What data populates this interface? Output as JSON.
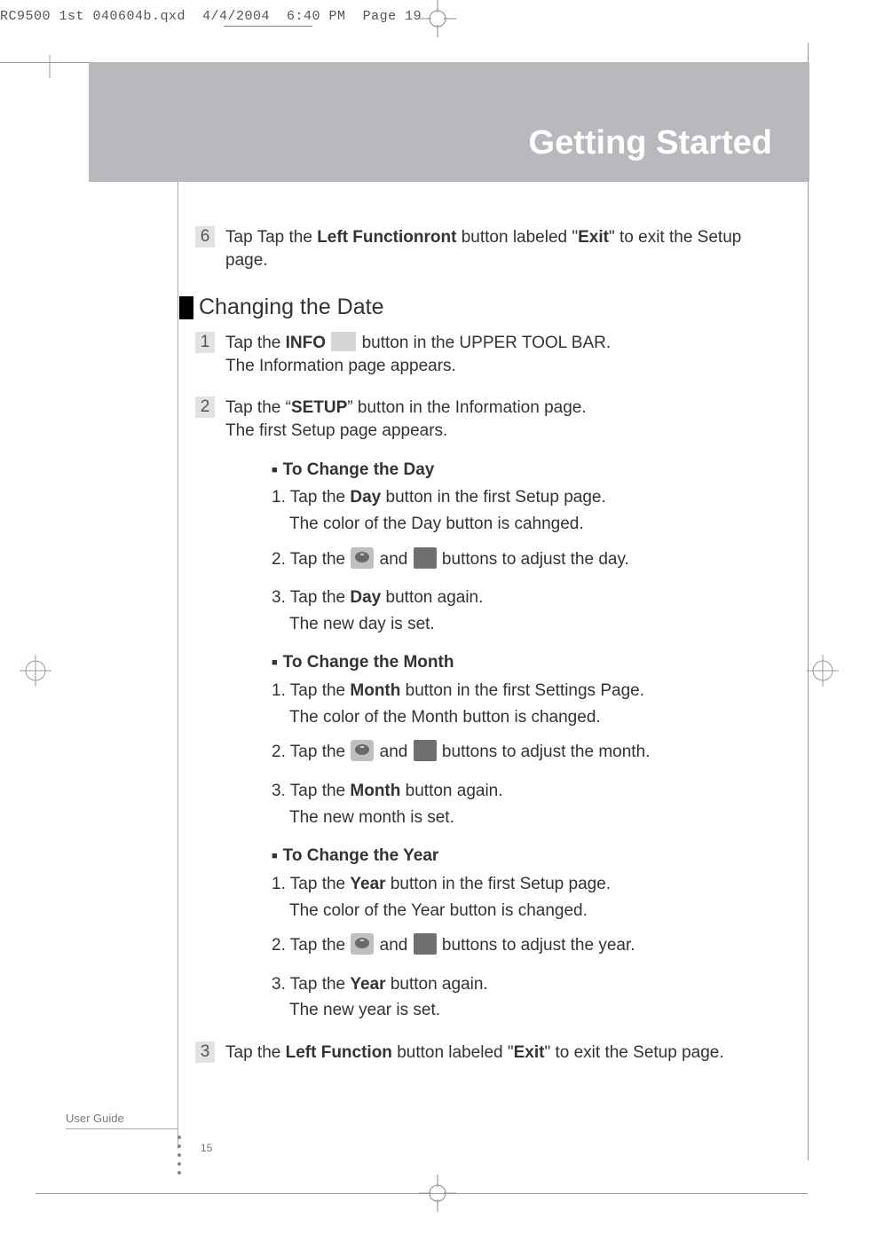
{
  "imposition_line": "RC9500 1st 040604b.qxd  4/4/2004  6:40 PM  Page 19",
  "banner_title": "Getting Started",
  "step6_a": "Tap Tap the ",
  "step6_b": "Left Functionront",
  "step6_c": " button labeled \"",
  "step6_d": "Exit",
  "step6_e": "\" to exit the Setup page.",
  "heading": "Changing the Date",
  "s1": {
    "a": "Tap the ",
    "b": "INFO",
    "c": " button in the UPPER TOOL BAR.",
    "d": "The Information page appears."
  },
  "s2": {
    "a": "Tap the “",
    "b": "SETUP",
    "c": "” button in the Information page.",
    "d": "The first Setup page appears."
  },
  "day": {
    "h": "To Change the Day",
    "l1a": "1. Tap the ",
    "l1b": "Day",
    "l1c": " button in the first Setup page.",
    "l1d": "The color of the Day button is cahnged.",
    "l2a": "2. Tap the ",
    "l2b": " and ",
    "l2c": " buttons to adjust the day.",
    "l3a": "3. Tap the ",
    "l3b": "Day",
    "l3c": " button again.",
    "l3d": "The new day is set."
  },
  "month": {
    "h": "To Change the Month",
    "l1a": "1. Tap the ",
    "l1b": "Month",
    "l1c": " button in the first Settings Page.",
    "l1d": "The color of the Month button is changed.",
    "l2a": "2. Tap the ",
    "l2b": " and ",
    "l2c": " buttons to adjust the month.",
    "l3a": "3. Tap the ",
    "l3b": "Month",
    "l3c": " button again.",
    "l3d": "The new month is set."
  },
  "year": {
    "h": "To Change the Year",
    "l1a": "1. Tap the ",
    "l1b": "Year",
    "l1c": " button in the first Setup page.",
    "l1d": "The color of the Year button is changed.",
    "l2a": "2. Tap the ",
    "l2b": " and ",
    "l2c": " buttons to adjust the year.",
    "l3a": "3. Tap the ",
    "l3b": "Year",
    "l3c": " button again.",
    "l3d": "The new year is set."
  },
  "s3": {
    "a": "Tap the ",
    "b": "Left Function",
    "c": " button labeled \"",
    "d": "Exit",
    "e": "\" to exit the Setup page."
  },
  "footer_label": "User Guide",
  "page_number": "15",
  "step_numbers": {
    "n6": "6",
    "n1": "1",
    "n2": "2",
    "n3": "3"
  }
}
